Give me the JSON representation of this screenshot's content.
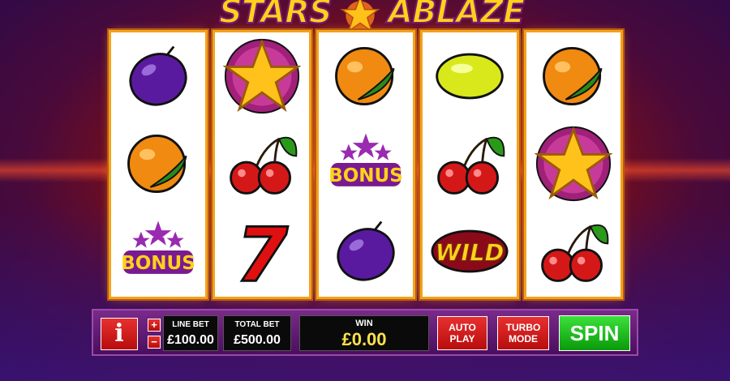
{
  "logo": {
    "word1": "STARS",
    "word2": "ABLAZE"
  },
  "reels": [
    [
      "plum-icon",
      "orange-icon",
      "bonus-icon"
    ],
    [
      "star-icon",
      "cherry-icon",
      "seven-icon"
    ],
    [
      "orange-icon",
      "bonus-icon",
      "plum-icon"
    ],
    [
      "lemon-icon",
      "cherry-icon",
      "wild-icon"
    ],
    [
      "orange-icon",
      "star-icon",
      "cherry-icon"
    ]
  ],
  "symbols": {
    "bonus_text": "BONUS",
    "wild_text": "WILD",
    "seven_text": "7"
  },
  "controls": {
    "info_label": "i",
    "plus_label": "+",
    "minus_label": "−",
    "line_bet_label": "LINE BET",
    "line_bet_value": "£100.00",
    "total_bet_label": "TOTAL BET",
    "total_bet_value": "£500.00",
    "win_label": "WIN",
    "win_value": "£0.00",
    "auto_play_line1": "AUTO",
    "auto_play_line2": "PLAY",
    "turbo_line1": "TURBO",
    "turbo_line2": "MODE",
    "spin_label": "SPIN"
  },
  "colors": {
    "accent_gold": "#ffd21a",
    "spin_green": "#1ec41e",
    "button_red": "#d41e1e"
  }
}
